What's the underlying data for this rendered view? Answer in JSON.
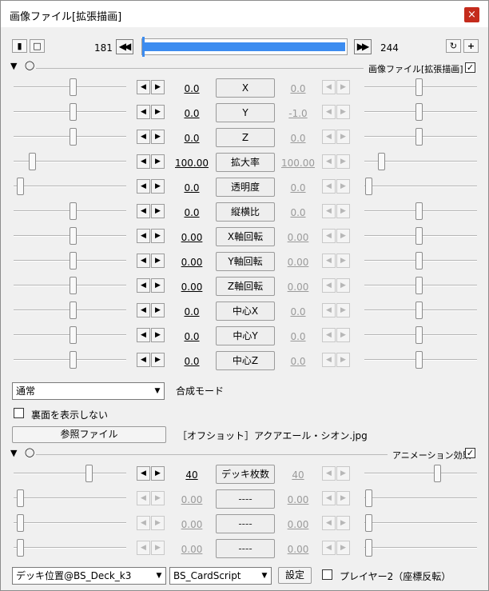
{
  "window": {
    "title": "画像ファイル[拡張描画]",
    "close_glyph": "×"
  },
  "toolbar": {
    "frame_start": "181",
    "frame_end": "244",
    "timeline_progress": 1.0,
    "prev_glyph": "◀◀",
    "next_glyph": "▶▶",
    "plus_glyph": "+"
  },
  "section1": {
    "label": "画像ファイル[拡張描画]",
    "checked": true
  },
  "params": [
    {
      "name": "X",
      "left": "0.0",
      "right": "0.0"
    },
    {
      "name": "Y",
      "left": "0.0",
      "right": "-1.0"
    },
    {
      "name": "Z",
      "left": "0.0",
      "right": "0.0"
    },
    {
      "name": "拡大率",
      "left": "100.00",
      "right": "100.00"
    },
    {
      "name": "透明度",
      "left": "0.0",
      "right": "0.0"
    },
    {
      "name": "縦横比",
      "left": "0.0",
      "right": "0.0"
    },
    {
      "name": "X軸回転",
      "left": "0.00",
      "right": "0.00"
    },
    {
      "name": "Y軸回転",
      "left": "0.00",
      "right": "0.00"
    },
    {
      "name": "Z軸回転",
      "left": "0.00",
      "right": "0.00"
    },
    {
      "name": "中心X",
      "left": "0.0",
      "right": "0.0"
    },
    {
      "name": "中心Y",
      "left": "0.0",
      "right": "0.0"
    },
    {
      "name": "中心Z",
      "left": "0.0",
      "right": "0.0"
    }
  ],
  "blend": {
    "selected": "通常",
    "label": "合成モード"
  },
  "backface": {
    "label": "裏面を表示しない",
    "checked": false
  },
  "reference": {
    "button": "参照ファイル",
    "filename": "［オフショット］アクアエール・シオン.jpg"
  },
  "section2": {
    "label": "アニメーション効果",
    "checked": true
  },
  "anim_params": [
    {
      "name": "デッキ枚数",
      "left": "40",
      "right": "40",
      "enabled": true
    },
    {
      "name": "----",
      "left": "0.00",
      "right": "0.00",
      "enabled": false
    },
    {
      "name": "----",
      "left": "0.00",
      "right": "0.00",
      "enabled": false
    },
    {
      "name": "----",
      "left": "0.00",
      "right": "0.00",
      "enabled": false
    }
  ],
  "bottom": {
    "deck_select": "デッキ位置@BS_Deck_k3",
    "script_select": "BS_CardScript",
    "settings_button": "設定",
    "player2_label": "プレイヤー2（座標反転）",
    "player2_checked": false
  }
}
